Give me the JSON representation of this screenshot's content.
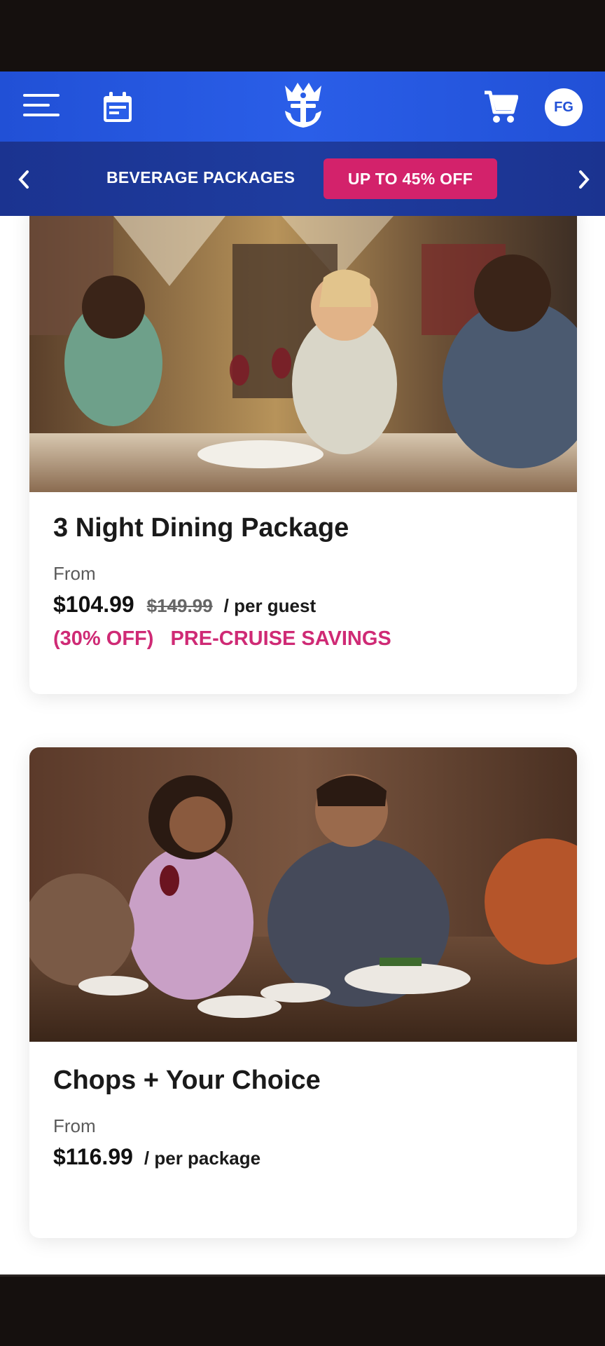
{
  "header": {
    "avatar_initials": "FG",
    "icons": [
      "hamburger-menu-icon",
      "calendar-icon",
      "royal-caribbean-crown-anchor-logo",
      "cart-icon"
    ],
    "brand_color": "#2150d6"
  },
  "promo": {
    "title": "BEVERAGE PACKAGES",
    "badge": "UP TO 45% OFF",
    "prev_icon": "chevron-left-icon",
    "next_icon": "chevron-right-icon",
    "badge_color": "#d3226b"
  },
  "cards": [
    {
      "title": "3 Night Dining Package",
      "from_label": "From",
      "price": "$104.99",
      "old_price": "$149.99",
      "per_label": "/ per guest",
      "discount": "(30% OFF)",
      "savings_label": "PRE-CRUISE SAVINGS"
    },
    {
      "title": "Chops + Your Choice",
      "from_label": "From",
      "price": "$116.99",
      "per_label": "/ per package"
    }
  ],
  "accent_color": "#cf2a75"
}
